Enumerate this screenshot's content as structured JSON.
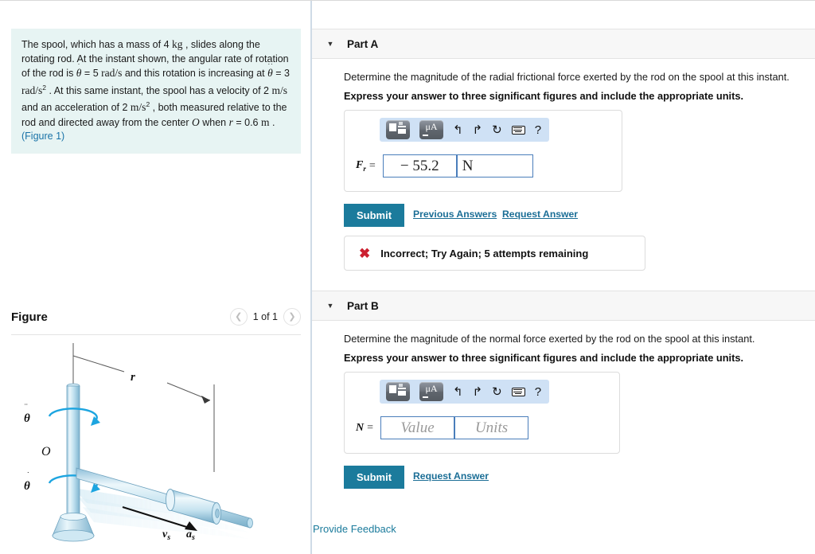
{
  "statement": {
    "lines": [
      "The spool, which has a mass of 4",
      "kg",
      ", slides along the rotating rod. At the instant shown, the angular rate of rotation of the rod is",
      "5",
      "rad/s",
      "and this rotation is increasing at",
      "3",
      "rad/s",
      ". At this same instant, the spool has a velocity of 2",
      "m/s",
      "and an acceleration of 2",
      "m/s",
      ", both measured relative to the rod and directed away from the center",
      "O",
      "when",
      "r",
      "= 0.6",
      "m",
      "."
    ],
    "figure_link": "(Figure 1)",
    "mass_value": "4",
    "mass_unit": "kg",
    "theta_dot_value": "5",
    "theta_dot_unit": "rad/s",
    "theta_ddot_value": "3",
    "theta_ddot_unit": "rad/s",
    "velocity_value": "2",
    "velocity_unit": "m/s",
    "accel_value": "2",
    "accel_unit": "m/s",
    "r_value": "0.6",
    "r_unit": "m",
    "center_label": "O"
  },
  "figure": {
    "title": "Figure",
    "count_label": "1 of 1",
    "prev_icon": "chevron-left-icon",
    "next_icon": "chevron-right-icon",
    "labels": {
      "theta_ddot": "θ",
      "theta_dot": "θ",
      "origin": "O",
      "radius": "r",
      "velocity": "v",
      "velocity_sub": "s",
      "accel": "a",
      "accel_sub": "s"
    }
  },
  "colors": {
    "accent": "#1b7b9c",
    "link": "#1b6e96",
    "statement_bg": "#e7f4f3",
    "toolbar_bg": "#cfe1f5",
    "field_border": "#4a7ebb",
    "error": "#cc2030",
    "part_header_bg": "#f7f7f7"
  },
  "toolbar": {
    "template_icon": "math-template-icon",
    "units_icon": "units-template-icon",
    "units_label": "μA",
    "undo_icon": "undo-icon",
    "undo_glyph": "↰",
    "redo_icon": "redo-icon",
    "redo_glyph": "↱",
    "reset_icon": "reset-icon",
    "reset_glyph": "↻",
    "keyboard_icon": "keyboard-icon",
    "help_icon": "help-icon",
    "help_glyph": "?"
  },
  "parts": [
    {
      "label": "Part A",
      "caret_icon": "caret-down-icon",
      "question": "Determine the magnitude of the radial frictional force exerted by the rod on the spool at this instant.",
      "instruction": "Express your answer to three significant figures and include the appropriate units.",
      "answer_var": "F",
      "answer_var_sub": "r",
      "answer_eq": "=",
      "value": "− 55.2",
      "value_placeholder": "Value",
      "units": "N",
      "units_placeholder": "Units",
      "submit_label": "Submit",
      "previous_answers_label": "Previous Answers",
      "request_answer_label": "Request Answer",
      "feedback": {
        "icon": "error-x-icon",
        "glyph": "✖",
        "text": "Incorrect; Try Again; 5 attempts remaining"
      }
    },
    {
      "label": "Part B",
      "caret_icon": "caret-down-icon",
      "question": "Determine the magnitude of the normal force exerted by the rod on the spool at this instant.",
      "instruction": "Express your answer to three significant figures and include the appropriate units.",
      "answer_var": "N",
      "answer_var_sub": "",
      "answer_eq": "=",
      "value": "",
      "value_placeholder": "Value",
      "units": "",
      "units_placeholder": "Units",
      "submit_label": "Submit",
      "request_answer_label": "Request Answer"
    }
  ],
  "footer": {
    "provide_feedback_label": "Provide Feedback"
  }
}
